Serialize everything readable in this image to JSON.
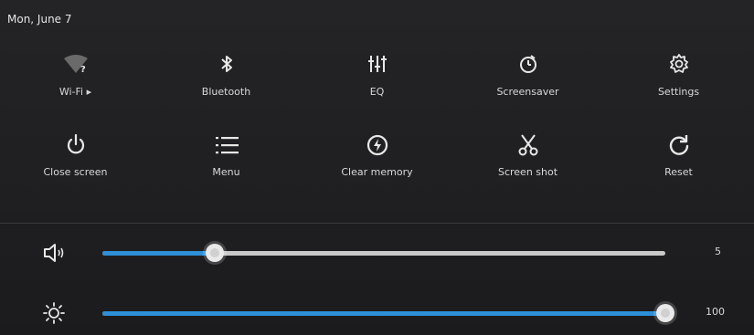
{
  "status": {
    "date": "Mon, June 7"
  },
  "tiles_row1": [
    {
      "id": "wifi",
      "label": "Wi-Fi  ▸",
      "icon": "wifi-icon"
    },
    {
      "id": "bluetooth",
      "label": "Bluetooth",
      "icon": "bluetooth-icon"
    },
    {
      "id": "eq",
      "label": "EQ",
      "icon": "equalizer-icon"
    },
    {
      "id": "screensaver",
      "label": "Screensaver",
      "icon": "timer-icon"
    },
    {
      "id": "settings",
      "label": "Settings",
      "icon": "gear-icon"
    }
  ],
  "tiles_row2": [
    {
      "id": "close-screen",
      "label": "Close screen",
      "icon": "power-icon"
    },
    {
      "id": "menu",
      "label": "Menu",
      "icon": "menu-list-icon"
    },
    {
      "id": "clear-memory",
      "label": "Clear memory",
      "icon": "clear-memory-icon"
    },
    {
      "id": "screen-shot",
      "label": "Screen shot",
      "icon": "scissors-icon"
    },
    {
      "id": "reset",
      "label": "Reset",
      "icon": "refresh-icon"
    }
  ],
  "sliders": {
    "volume": {
      "value": "5",
      "fraction": 0.2,
      "icon": "speaker-icon"
    },
    "brightness": {
      "value": "100",
      "fraction": 1.0,
      "icon": "sun-icon"
    }
  },
  "colors": {
    "accent": "#2d8fd6",
    "track": "#c9c9c9",
    "background": "#1f1f21",
    "text": "#d9d9d9"
  }
}
